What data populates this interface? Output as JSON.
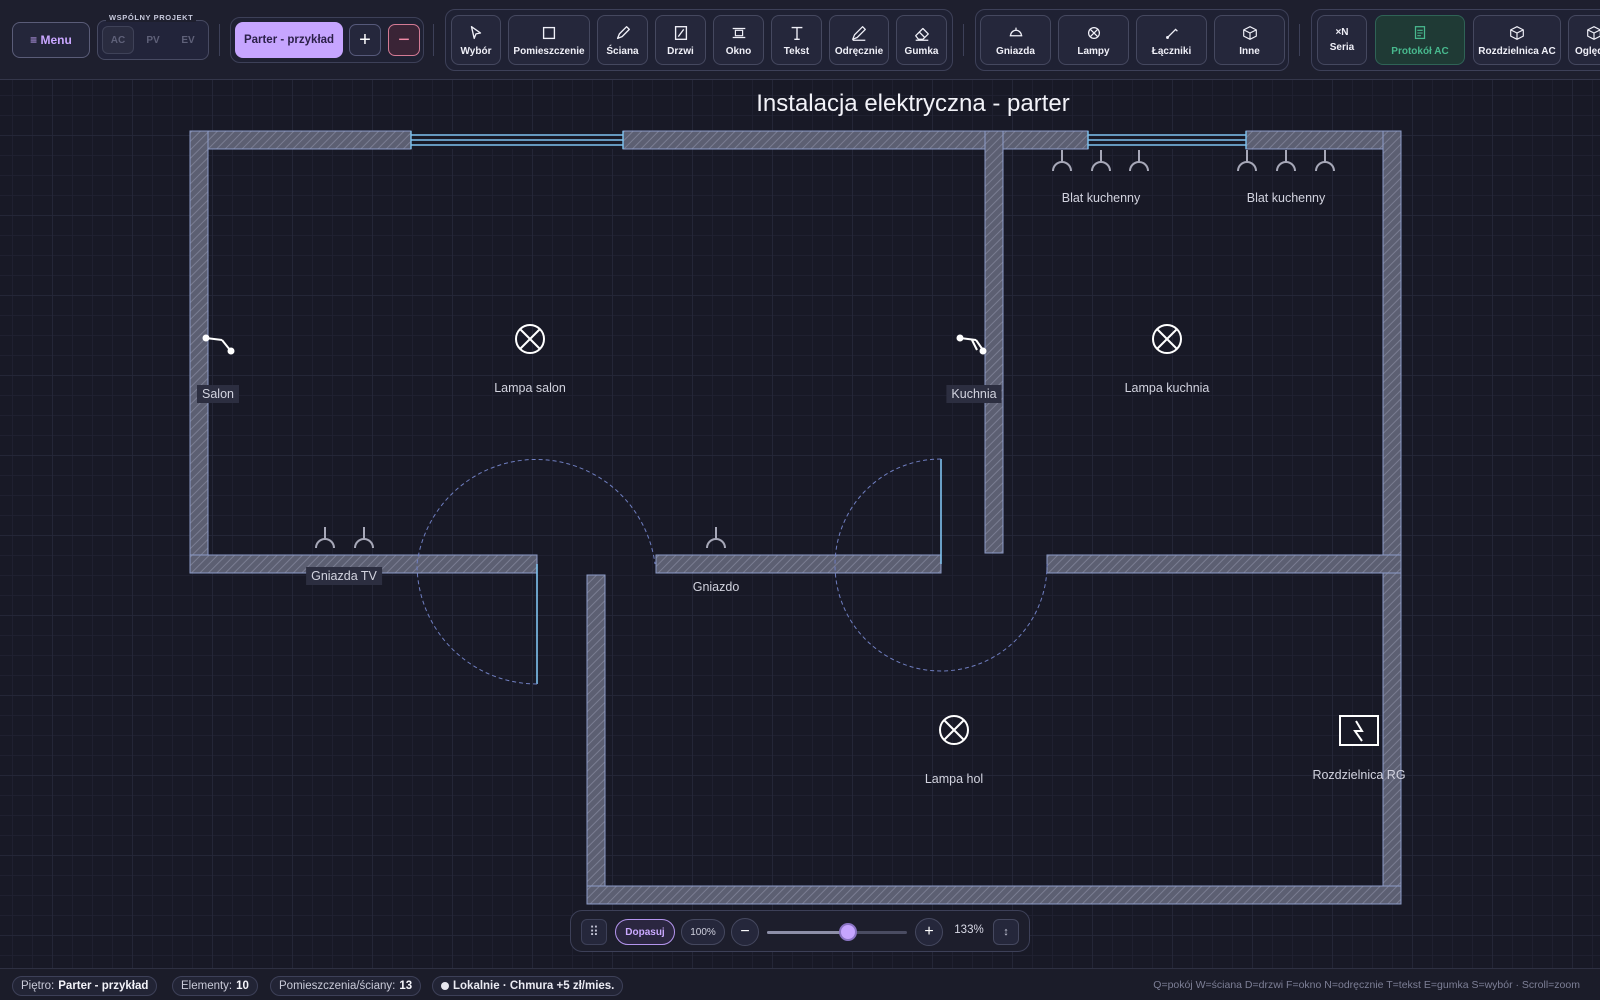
{
  "toolbar": {
    "menu_label": "≡ Menu",
    "shared_project": {
      "label": "WSPÓLNY PROJEKT",
      "buttons": [
        "AC",
        "PV",
        "EV"
      ]
    },
    "floor": {
      "current": "Parter - przykład",
      "add_symbol": "+",
      "remove_symbol": "−"
    },
    "draw_tools": [
      "Wybór",
      "Pomieszczenie",
      "Ściana",
      "Drzwi",
      "Okno",
      "Tekst",
      "Odręcznie",
      "Gumka"
    ],
    "electrical_tools": [
      "Gniazda",
      "Lampy",
      "Łączniki",
      "Inne"
    ],
    "extra_tools": {
      "series_top": "×N",
      "series_label": "Seria",
      "protocol_label": "Protokół AC",
      "panel_label": "Rozdzielnica AC",
      "inspection_label": "Oględ"
    }
  },
  "canvas": {
    "title": "Instalacja elektryczna - parter",
    "labels": {
      "salon": "Salon",
      "kuchnia": "Kuchnia",
      "lamp_salon": "Lampa salon",
      "lamp_kuchnia": "Lampa kuchnia",
      "lamp_hol": "Lampa hol",
      "gniazda_tv": "Gniazda TV",
      "gniazdo": "Gniazdo",
      "blat1": "Blat kuchenny",
      "blat2": "Blat kuchenny",
      "rozdzielnica": "Rozdzielnica RG"
    }
  },
  "zoom": {
    "fit_label": "Dopasuj",
    "reset_label": "100%",
    "minus": "−",
    "plus": "+",
    "level_text": "133%",
    "slider_fraction": 0.58
  },
  "status": {
    "floor_label": "Piętro:",
    "floor_value": "Parter - przykład",
    "elements_label": "Elementy:",
    "elements_value": "10",
    "rooms_label": "Pomieszczenia/ściany:",
    "rooms_value": "13",
    "storage": "Lokalnie · Chmura +5 zł/mies.",
    "shortcuts": "Q=pokój W=ściana D=drzwi F=okno N=odręcznie T=tekst E=gumka S=wybór · Scroll=zoom"
  },
  "colors": {
    "accent": "#c6a5ff",
    "wall_border": "#8c9bc8",
    "window": "#7fc3f0",
    "protocol": "#48b98e"
  }
}
